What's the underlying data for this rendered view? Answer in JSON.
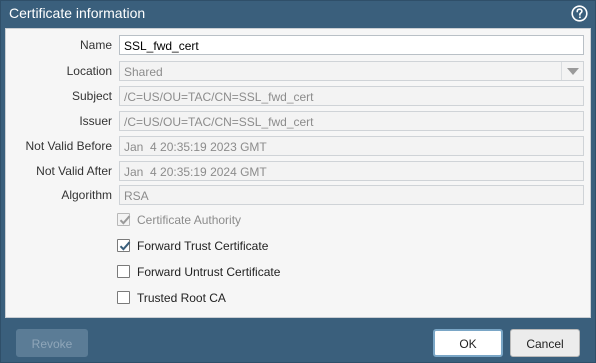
{
  "dialog": {
    "title": "Certificate information"
  },
  "fields": {
    "name": {
      "label": "Name",
      "value": "SSL_fwd_cert"
    },
    "location": {
      "label": "Location",
      "value": "Shared"
    },
    "subject": {
      "label": "Subject",
      "value": "/C=US/OU=TAC/CN=SSL_fwd_cert"
    },
    "issuer": {
      "label": "Issuer",
      "value": "/C=US/OU=TAC/CN=SSL_fwd_cert"
    },
    "not_valid_before": {
      "label": "Not Valid Before",
      "value": "Jan  4 20:35:19 2023 GMT"
    },
    "not_valid_after": {
      "label": "Not Valid After",
      "value": "Jan  4 20:35:19 2024 GMT"
    },
    "algorithm": {
      "label": "Algorithm",
      "value": "RSA"
    }
  },
  "checkboxes": {
    "certificate_authority": {
      "label": "Certificate Authority",
      "checked": true,
      "disabled": true
    },
    "forward_trust": {
      "label": "Forward Trust Certificate",
      "checked": true,
      "disabled": false
    },
    "forward_untrust": {
      "label": "Forward Untrust Certificate",
      "checked": false,
      "disabled": false
    },
    "trusted_root_ca": {
      "label": "Trusted Root CA",
      "checked": false,
      "disabled": false
    }
  },
  "footer": {
    "revoke_label": "Revoke",
    "ok_label": "OK",
    "cancel_label": "Cancel"
  },
  "icons": {
    "help": "help-icon",
    "dropdown": "chevron-down-icon",
    "check": "check-icon"
  },
  "colors": {
    "header_bg": "#3a5f7c",
    "body_bg": "#f6f6f6",
    "ok_border": "#7aa6c6"
  }
}
